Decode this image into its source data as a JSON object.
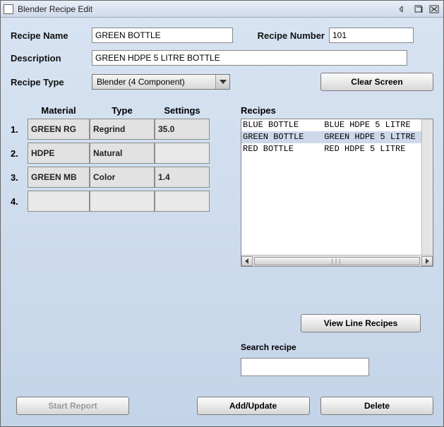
{
  "window": {
    "title": "Blender Recipe Edit"
  },
  "form": {
    "recipe_name_label": "Recipe Name",
    "recipe_name_value": "GREEN BOTTLE",
    "recipe_number_label": "Recipe Number",
    "recipe_number_value": "101",
    "description_label": "Description",
    "description_value": "GREEN HDPE 5 LITRE BOTTLE",
    "recipe_type_label": "Recipe Type",
    "recipe_type_value": "Blender (4 Component)"
  },
  "material_grid": {
    "headers": {
      "material": "Material",
      "type": "Type",
      "settings": "Settings"
    },
    "rows": [
      {
        "num": "1.",
        "material": "GREEN RG",
        "type": "Regrind",
        "settings": "35.0"
      },
      {
        "num": "2.",
        "material": "HDPE",
        "type": "Natural",
        "settings": ""
      },
      {
        "num": "3.",
        "material": "GREEN MB",
        "type": "Color",
        "settings": "1.4"
      },
      {
        "num": "4.",
        "material": "",
        "type": "",
        "settings": ""
      }
    ]
  },
  "recipes": {
    "header": "Recipes",
    "items": [
      {
        "name": "BLUE BOTTLE",
        "desc": "BLUE HDPE 5 LITRE",
        "selected": false
      },
      {
        "name": "GREEN BOTTLE",
        "desc": "GREEN HDPE 5 LITRE",
        "selected": true
      },
      {
        "name": "RED BOTTLE",
        "desc": "RED HDPE 5 LITRE",
        "selected": false
      }
    ]
  },
  "buttons": {
    "clear_screen": "Clear Screen",
    "view_line_recipes": "View Line Recipes",
    "start_report": "Start Report",
    "add_update": "Add/Update",
    "delete": "Delete"
  },
  "search": {
    "label": "Search recipe",
    "value": ""
  }
}
